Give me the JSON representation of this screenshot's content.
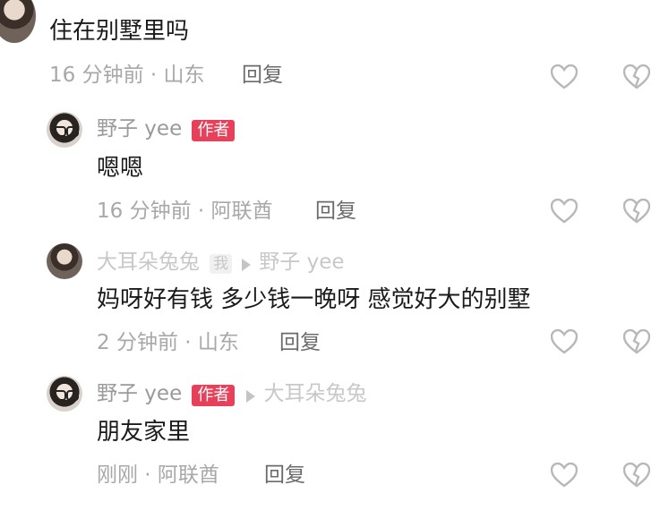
{
  "top_comment": {
    "text": "住在别墅里吗",
    "time": "16 分钟前 · 山东",
    "reply_label": "回复"
  },
  "replies": [
    {
      "author": "野子 yee",
      "badge": "作者",
      "text": "嗯嗯",
      "time": "16 分钟前 · 阿联酋",
      "reply_label": "回复"
    },
    {
      "author": "大耳朵兔兔",
      "self_tag": "我",
      "reply_to": "野子 yee",
      "text": "妈呀好有钱 多少钱一晚呀 感觉好大的别墅",
      "time": "2 分钟前 · 山东",
      "reply_label": "回复"
    },
    {
      "author": "野子 yee",
      "badge": "作者",
      "reply_to": "大耳朵兔兔",
      "text": "朋友家里",
      "time": "刚刚 · 阿联酋",
      "reply_label": "回复"
    }
  ],
  "icons": {
    "like": "heart-outline-icon",
    "dislike": "broken-heart-outline-icon"
  },
  "colors": {
    "author_badge": "#e7405a",
    "meta_text": "#a8a8a8",
    "content_text": "#1a1a1a"
  }
}
